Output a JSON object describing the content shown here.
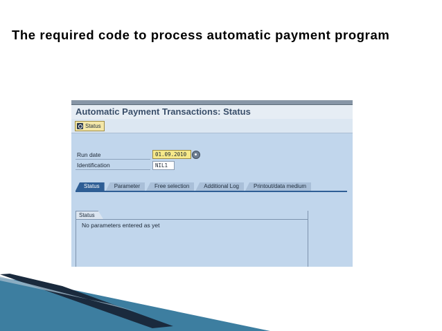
{
  "slide": {
    "title": "The required code to process automatic payment program"
  },
  "window": {
    "title": "Automatic Payment Transactions: Status",
    "toolbar": {
      "status_button_label": "Status",
      "status_button_icon": "status-overview-icon"
    },
    "fields": {
      "run_date": {
        "label": "Run date",
        "value": "01.09.2010"
      },
      "identification": {
        "label": "Identification",
        "value": "NIL1"
      }
    },
    "tabs": [
      {
        "label": "Status",
        "active": true
      },
      {
        "label": "Parameter",
        "active": false
      },
      {
        "label": "Free selection",
        "active": false
      },
      {
        "label": "Additional Log",
        "active": false
      },
      {
        "label": "Printout/data medium",
        "active": false
      }
    ],
    "status_group": {
      "label": "Status",
      "message": "No parameters entered as yet"
    }
  },
  "colors": {
    "active_tab": "#2e5e95",
    "window_bg": "#c1d6ec",
    "input_highlight": "#f6e98a",
    "swoosh_dark": "#1a2a3d",
    "swoosh_light": "#3d7ea0"
  }
}
